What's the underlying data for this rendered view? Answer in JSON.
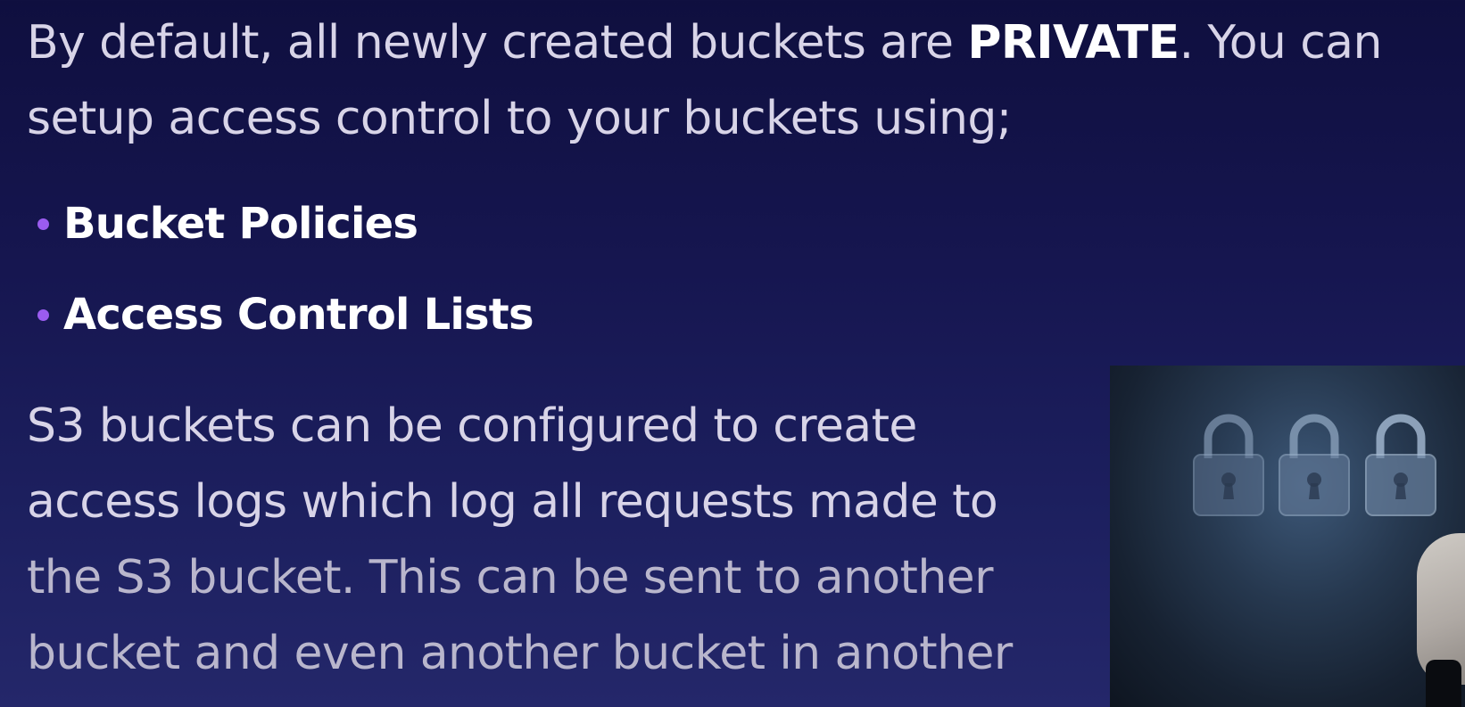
{
  "intro": {
    "before_emphasis": "By default, all newly created buckets are ",
    "emphasis": "PRIVATE",
    "after_emphasis": ". You can",
    "line2": "setup access control to your buckets using;"
  },
  "bullets": [
    "Bucket Policies",
    "Access Control Lists"
  ],
  "logs_paragraph": {
    "line1": "S3 buckets can be configured to create",
    "line2": "access logs which log all requests made to",
    "line3": "the S3 bucket. This can be sent to another",
    "line4": "bucket and even another bucket in another"
  },
  "colors": {
    "background": "#161650",
    "bullet_accent": "#9b5cf0",
    "emphasis_text": "#ffffff",
    "body_text": "#d8d4e8"
  },
  "photo": {
    "icons": [
      "padlock-icon",
      "padlock-icon",
      "padlock-icon"
    ]
  }
}
